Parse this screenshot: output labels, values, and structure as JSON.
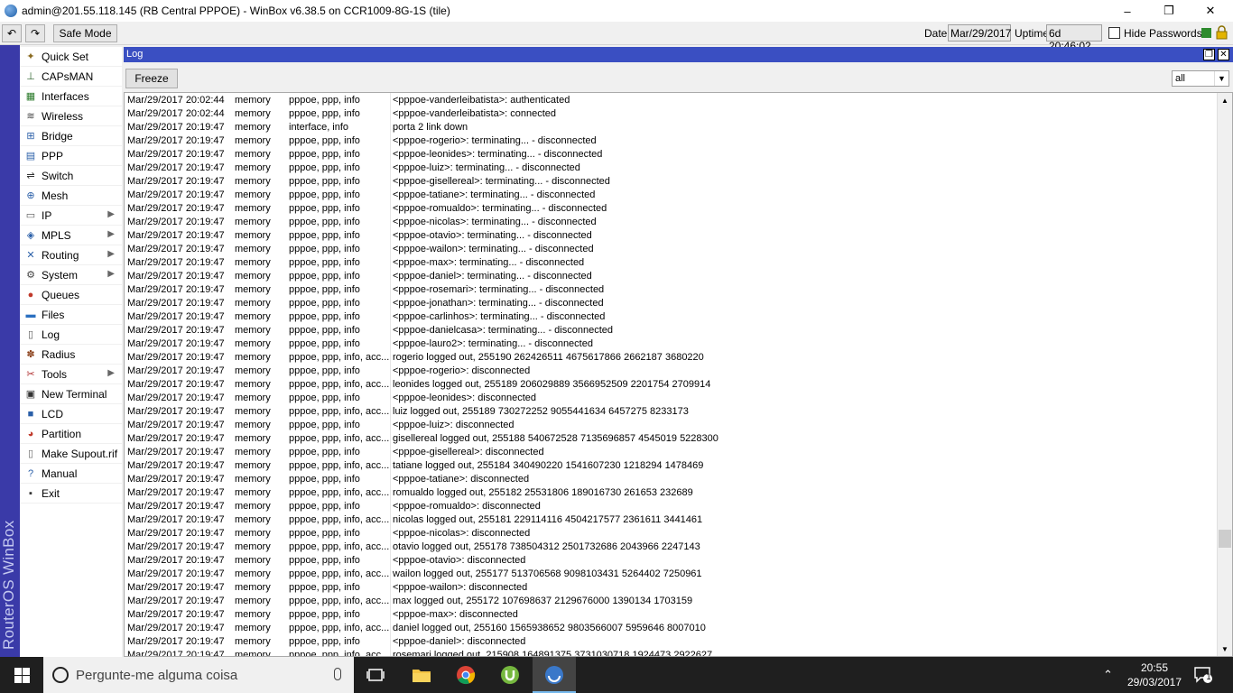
{
  "window": {
    "title": "admin@201.55.118.145 (RB Central PPPOE) - WinBox v6.38.5 on CCR1009-8G-1S (tile)",
    "minimize": "–",
    "maximize": "❐",
    "close": "✕"
  },
  "toolbar": {
    "undo": "↶",
    "redo": "↷",
    "safe_mode": "Safe Mode",
    "date_label": "Date:",
    "date_value": "Mar/29/2017",
    "uptime_label": "Uptime:",
    "uptime_value": "6d 20:46:02",
    "hide_passwords": "Hide Passwords",
    "status_colors": {
      "green": "#2e8b2e",
      "lock": "#d9a400"
    }
  },
  "brand": "RouterOS WinBox",
  "sidebar": {
    "items": [
      {
        "label": "Quick Set",
        "icon": "wand-icon"
      },
      {
        "label": "CAPsMAN",
        "icon": "antenna-icon"
      },
      {
        "label": "Interfaces",
        "icon": "interfaces-icon"
      },
      {
        "label": "Wireless",
        "icon": "wireless-icon"
      },
      {
        "label": "Bridge",
        "icon": "bridge-icon"
      },
      {
        "label": "PPP",
        "icon": "ppp-icon"
      },
      {
        "label": "Switch",
        "icon": "switch-icon"
      },
      {
        "label": "Mesh",
        "icon": "mesh-icon"
      },
      {
        "label": "IP",
        "icon": "ip-icon",
        "submenu": "▶"
      },
      {
        "label": "MPLS",
        "icon": "mpls-icon",
        "submenu": "▶"
      },
      {
        "label": "Routing",
        "icon": "routing-icon",
        "submenu": "▶"
      },
      {
        "label": "System",
        "icon": "gear-icon",
        "submenu": "▶"
      },
      {
        "label": "Queues",
        "icon": "queues-icon"
      },
      {
        "label": "Files",
        "icon": "folder-icon"
      },
      {
        "label": "Log",
        "icon": "log-icon"
      },
      {
        "label": "Radius",
        "icon": "radius-icon"
      },
      {
        "label": "Tools",
        "icon": "tools-icon",
        "submenu": "▶"
      },
      {
        "label": "New Terminal",
        "icon": "terminal-icon"
      },
      {
        "label": "LCD",
        "icon": "lcd-icon"
      },
      {
        "label": "Partition",
        "icon": "partition-icon"
      },
      {
        "label": "Make Supout.rif",
        "icon": "file-icon"
      },
      {
        "label": "Manual",
        "icon": "book-icon"
      },
      {
        "label": "Exit",
        "icon": "exit-icon"
      }
    ]
  },
  "log": {
    "title": "Log",
    "freeze": "Freeze",
    "filter": "all",
    "rows": [
      [
        "Mar/29/2017 20:02:44",
        "memory",
        "pppoe, ppp, info",
        "<pppoe-vanderleibatista>: authenticated"
      ],
      [
        "Mar/29/2017 20:02:44",
        "memory",
        "pppoe, ppp, info",
        "<pppoe-vanderleibatista>: connected"
      ],
      [
        "Mar/29/2017 20:19:47",
        "memory",
        "interface, info",
        "porta 2 link down"
      ],
      [
        "Mar/29/2017 20:19:47",
        "memory",
        "pppoe, ppp, info",
        "<pppoe-rogerio>: terminating... - disconnected"
      ],
      [
        "Mar/29/2017 20:19:47",
        "memory",
        "pppoe, ppp, info",
        "<pppoe-leonides>: terminating... - disconnected"
      ],
      [
        "Mar/29/2017 20:19:47",
        "memory",
        "pppoe, ppp, info",
        "<pppoe-luiz>: terminating... - disconnected"
      ],
      [
        "Mar/29/2017 20:19:47",
        "memory",
        "pppoe, ppp, info",
        "<pppoe-gisellereal>: terminating... - disconnected"
      ],
      [
        "Mar/29/2017 20:19:47",
        "memory",
        "pppoe, ppp, info",
        "<pppoe-tatiane>: terminating... - disconnected"
      ],
      [
        "Mar/29/2017 20:19:47",
        "memory",
        "pppoe, ppp, info",
        "<pppoe-romualdo>: terminating... - disconnected"
      ],
      [
        "Mar/29/2017 20:19:47",
        "memory",
        "pppoe, ppp, info",
        "<pppoe-nicolas>: terminating... - disconnected"
      ],
      [
        "Mar/29/2017 20:19:47",
        "memory",
        "pppoe, ppp, info",
        "<pppoe-otavio>: terminating... - disconnected"
      ],
      [
        "Mar/29/2017 20:19:47",
        "memory",
        "pppoe, ppp, info",
        "<pppoe-wailon>: terminating... - disconnected"
      ],
      [
        "Mar/29/2017 20:19:47",
        "memory",
        "pppoe, ppp, info",
        "<pppoe-max>: terminating... - disconnected"
      ],
      [
        "Mar/29/2017 20:19:47",
        "memory",
        "pppoe, ppp, info",
        "<pppoe-daniel>: terminating... - disconnected"
      ],
      [
        "Mar/29/2017 20:19:47",
        "memory",
        "pppoe, ppp, info",
        "<pppoe-rosemari>: terminating... - disconnected"
      ],
      [
        "Mar/29/2017 20:19:47",
        "memory",
        "pppoe, ppp, info",
        "<pppoe-jonathan>: terminating... - disconnected"
      ],
      [
        "Mar/29/2017 20:19:47",
        "memory",
        "pppoe, ppp, info",
        "<pppoe-carlinhos>: terminating... - disconnected"
      ],
      [
        "Mar/29/2017 20:19:47",
        "memory",
        "pppoe, ppp, info",
        "<pppoe-danielcasa>: terminating... - disconnected"
      ],
      [
        "Mar/29/2017 20:19:47",
        "memory",
        "pppoe, ppp, info",
        "<pppoe-lauro2>: terminating... - disconnected"
      ],
      [
        "Mar/29/2017 20:19:47",
        "memory",
        "pppoe, ppp, info, acc...",
        "rogerio logged out, 255190 262426511 4675617866 2662187 3680220"
      ],
      [
        "Mar/29/2017 20:19:47",
        "memory",
        "pppoe, ppp, info",
        "<pppoe-rogerio>: disconnected"
      ],
      [
        "Mar/29/2017 20:19:47",
        "memory",
        "pppoe, ppp, info, acc...",
        "leonides logged out, 255189 206029889 3566952509 2201754 2709914"
      ],
      [
        "Mar/29/2017 20:19:47",
        "memory",
        "pppoe, ppp, info",
        "<pppoe-leonides>: disconnected"
      ],
      [
        "Mar/29/2017 20:19:47",
        "memory",
        "pppoe, ppp, info, acc...",
        "luiz logged out, 255189 730272252 9055441634 6457275 8233173"
      ],
      [
        "Mar/29/2017 20:19:47",
        "memory",
        "pppoe, ppp, info",
        "<pppoe-luiz>: disconnected"
      ],
      [
        "Mar/29/2017 20:19:47",
        "memory",
        "pppoe, ppp, info, acc...",
        "gisellereal logged out, 255188 540672528 7135696857 4545019 5228300"
      ],
      [
        "Mar/29/2017 20:19:47",
        "memory",
        "pppoe, ppp, info",
        "<pppoe-gisellereal>: disconnected"
      ],
      [
        "Mar/29/2017 20:19:47",
        "memory",
        "pppoe, ppp, info, acc...",
        "tatiane logged out, 255184 340490220 1541607230 1218294 1478469"
      ],
      [
        "Mar/29/2017 20:19:47",
        "memory",
        "pppoe, ppp, info",
        "<pppoe-tatiane>: disconnected"
      ],
      [
        "Mar/29/2017 20:19:47",
        "memory",
        "pppoe, ppp, info, acc...",
        "romualdo logged out, 255182 25531806 189016730 261653 232689"
      ],
      [
        "Mar/29/2017 20:19:47",
        "memory",
        "pppoe, ppp, info",
        "<pppoe-romualdo>: disconnected"
      ],
      [
        "Mar/29/2017 20:19:47",
        "memory",
        "pppoe, ppp, info, acc...",
        "nicolas logged out, 255181 229114116 4504217577 2361611 3441461"
      ],
      [
        "Mar/29/2017 20:19:47",
        "memory",
        "pppoe, ppp, info",
        "<pppoe-nicolas>: disconnected"
      ],
      [
        "Mar/29/2017 20:19:47",
        "memory",
        "pppoe, ppp, info, acc...",
        "otavio logged out, 255178 738504312 2501732686 2043966 2247143"
      ],
      [
        "Mar/29/2017 20:19:47",
        "memory",
        "pppoe, ppp, info",
        "<pppoe-otavio>: disconnected"
      ],
      [
        "Mar/29/2017 20:19:47",
        "memory",
        "pppoe, ppp, info, acc...",
        "wailon logged out, 255177 513706568 9098103431 5264402 7250961"
      ],
      [
        "Mar/29/2017 20:19:47",
        "memory",
        "pppoe, ppp, info",
        "<pppoe-wailon>: disconnected"
      ],
      [
        "Mar/29/2017 20:19:47",
        "memory",
        "pppoe, ppp, info, acc...",
        "max logged out, 255172 107698637 2129676000 1390134 1703159"
      ],
      [
        "Mar/29/2017 20:19:47",
        "memory",
        "pppoe, ppp, info",
        "<pppoe-max>: disconnected"
      ],
      [
        "Mar/29/2017 20:19:47",
        "memory",
        "pppoe, ppp, info, acc...",
        "daniel logged out, 255160 1565938652 9803566007 5959646 8007010"
      ],
      [
        "Mar/29/2017 20:19:47",
        "memory",
        "pppoe, ppp, info",
        "<pppoe-daniel>: disconnected"
      ],
      [
        "Mar/29/2017 20:19:47",
        "memory",
        "pppoe, ppp, info, acc...",
        "rosemari logged out, 215908 164891375 3731030718 1924473 2922627"
      ]
    ]
  },
  "taskbar": {
    "search_placeholder": "Pergunte-me alguma coisa",
    "time": "20:55",
    "date": "29/03/2017",
    "tray_caret": "⌃",
    "notification_count": "1"
  }
}
